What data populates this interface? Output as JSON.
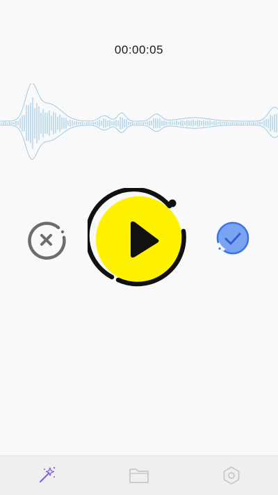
{
  "recorder": {
    "elapsed_time": "00:00:05"
  },
  "colors": {
    "background": "#f9f9f9",
    "waveform": "#9ccbe8",
    "play_fill": "#fff200",
    "play_outline": "#111111",
    "cancel_gray": "#6d6d6d",
    "confirm_blue": "#5b8ef0",
    "tab_active": "#8a63d2",
    "tab_inactive": "#c8c8c8"
  },
  "controls": {
    "cancel_icon": "close-circle-icon",
    "play_icon": "play-icon",
    "confirm_icon": "check-circle-icon"
  },
  "tabbar": {
    "items": [
      {
        "icon": "magic-wand-icon",
        "active": true
      },
      {
        "icon": "folder-icon",
        "active": false
      },
      {
        "icon": "settings-hexagon-icon",
        "active": false
      }
    ]
  }
}
